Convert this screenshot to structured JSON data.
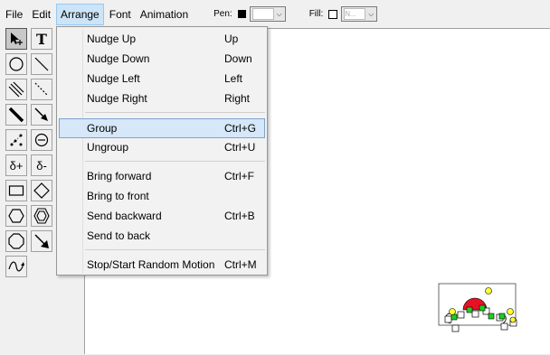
{
  "menubar": {
    "items": [
      {
        "label": "File"
      },
      {
        "label": "Edit"
      },
      {
        "label": "Arrange"
      },
      {
        "label": "Font"
      },
      {
        "label": "Animation"
      }
    ],
    "pen_label": "Pen:",
    "fill_label": "Fill:",
    "fill_value": "N..."
  },
  "toolbox": {
    "text_tool_glyph": "T",
    "delta_plus": "δ+",
    "delta_minus": "δ-"
  },
  "arrange_menu": {
    "items": [
      {
        "label": "Nudge Up",
        "shortcut": "Up"
      },
      {
        "label": "Nudge Down",
        "shortcut": "Down"
      },
      {
        "label": "Nudge Left",
        "shortcut": "Left"
      },
      {
        "label": "Nudge Right",
        "shortcut": "Right"
      },
      {
        "label": "Group",
        "shortcut": "Ctrl+G"
      },
      {
        "label": "Ungroup",
        "shortcut": "Ctrl+U"
      },
      {
        "label": "Bring forward",
        "shortcut": "Ctrl+F"
      },
      {
        "label": "Bring to front",
        "shortcut": ""
      },
      {
        "label": "Send backward",
        "shortcut": "Ctrl+B"
      },
      {
        "label": "Send to back",
        "shortcut": ""
      },
      {
        "label": "Stop/Start Random Motion",
        "shortcut": "Ctrl+M"
      }
    ],
    "highlighted": "Group"
  },
  "colors": {
    "menu_highlight": "#d5e7f8",
    "selected_shape_fill": "#e81123",
    "handle_green": "#22cc22",
    "handle_yellow": "#ffff33"
  }
}
